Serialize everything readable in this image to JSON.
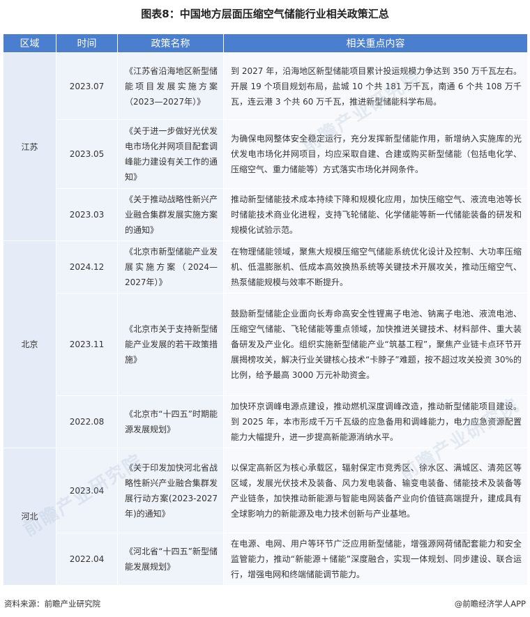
{
  "title": "图表8：中国地方层面压缩空气储能行业相关政策汇总",
  "headers": [
    "区域",
    "时间",
    "政策名称",
    "相关重点内容"
  ],
  "regions": [
    {
      "name": "江苏",
      "rows": [
        {
          "time": "2023.07",
          "policy": "《江苏省沿海地区新型储能项目发展实施方案（2023—2027年）》",
          "content": "到 2027 年，沿海地区新型储能项目累计投运规模力争达到 350 万千瓦左右。开展 19 个项目规划布局，盐城 10 个共 181 万千瓦，南通 6 个共 108 万千瓦，连云港 3 个共 60 万千瓦，推进新型储能科学布局。"
        },
        {
          "time": "2023.05",
          "policy": "《关于进一步做好光伏发电市场化并网项目配套调峰能力建设有关工作的通知》",
          "content": "为确保电网整体安全稳定运行，充分发挥新型储能作用，新增纳入实施库的光伏发电市场化并网项目，均应采取自建、合建或购买新型储能（包括电化学、压缩空气、重力储能等）方式落实市场化并网条件。"
        },
        {
          "time": "2023.03",
          "policy": "《关于推动战略性新兴产业融合集群发展实施方案的通知》",
          "content": "推动新型储能技术成本持续下降和规模化应用，加快压缩空气、液流电池等长时储能技术商业化进程，支持飞轮储能、化学储能等新一代储能装备的研发和规模化试验示范。"
        }
      ]
    },
    {
      "name": "北京",
      "rows": [
        {
          "time": "2024.12",
          "policy": "《北京市新型储能产业发展实施方案（2024—2027年）》",
          "content": "在物理储能领域，聚焦大规模压缩空气储能系统优化设计及控制、大功率压缩机、低温膨胀机、低成本高效换热系统等关键技术开展攻关，推动压缩空气、热泵储能规模与效率不断提升。"
        },
        {
          "time": "2023.11",
          "policy": "《北京市关于支持新型储能产业发展的若干政策措施》",
          "content": "鼓励新型储能企业面向长寿命高安全性锂离子电池、钠离子电池、液流电池、压缩空气储能、飞轮储能等重点领域，加快推进关键技术、材料部件、重大装备研发及产业化。组织实施新型储能产业“筑基工程”，聚焦产业链卡点环节开展揭榜攻关，解决行业关键核心技术“卡脖子”难题，按不超过攻关投资 30%的比例，给予最高 3000 万元补助资金。"
        },
        {
          "time": "2022.08",
          "policy": "《北京市“十四五”时期能源发展规划》",
          "content": "加快环京调峰电源点建设，推动燃机深度调峰改造，推动新型储能项目建设。到 2025 年，本市形成千万千瓦级的应急备用和调峰能力，电力应急资源配置能力大幅提升，进一步提高新能源消纳水平。"
        }
      ]
    },
    {
      "name": "河北",
      "rows": [
        {
          "time": "2023.04",
          "policy": "《关于印发加快河北省战略性新兴产业融合集群发展行动方案(2023-2027 年)的通知》",
          "content": "以保定高新区为核心承载区，辐射保定市竞秀区、徐水区、满城区、清苑区等区域，发展光伏技术及装备、风力发电装备、输变电装备、储能技术及装备等产业链条，加快推动新能源与智能电网装备产业向价值链高端提升，建成具有全球影响力的新能源及电力技术创新与产业基地。"
        },
        {
          "time": "2022.04",
          "policy": "《河北省“十四五”新型储能发展规划》",
          "content": "在电源、电网、用户等环节广泛应用新型储能，增强源网荷储配套能力和安全监管能力，推动“新能源＋储能”深度融合，实现一体规划、同步建设、联合运行，增强电网和终端储能调节能力。"
        }
      ]
    }
  ],
  "source": "资料来源：前瞻产业研究院",
  "credit": "@前瞻经济学人APP",
  "watermark": "前瞻产业研究院"
}
